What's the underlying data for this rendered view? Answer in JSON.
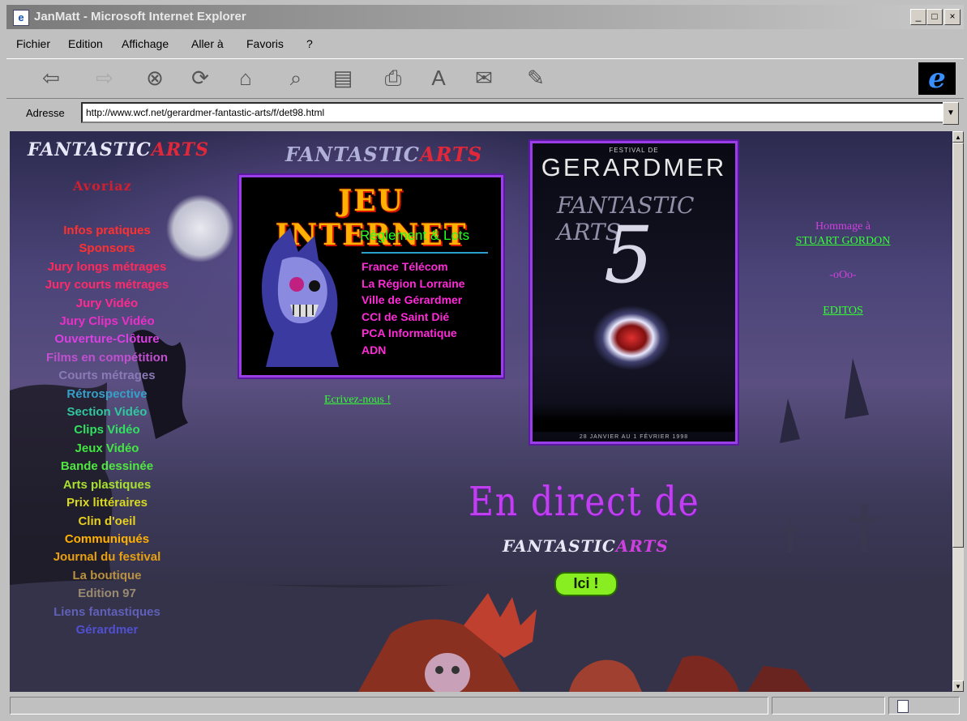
{
  "window": {
    "title": "JanMatt - Microsoft Internet Explorer",
    "controls": {
      "minimize": "_",
      "maximize": "□",
      "close": "×"
    }
  },
  "menu": [
    "Fichier",
    "Edition",
    "Affichage",
    "Aller à",
    "Favoris",
    "?"
  ],
  "toolbar": {
    "buttons": [
      {
        "name": "back-icon",
        "glyph": "⇦"
      },
      {
        "name": "forward-icon",
        "glyph": "⇨"
      },
      {
        "name": "stop-icon",
        "glyph": "⊗"
      },
      {
        "name": "refresh-icon",
        "glyph": "⟳"
      },
      {
        "name": "home-icon",
        "glyph": "⌂"
      },
      {
        "name": "search-icon",
        "glyph": "⌕"
      },
      {
        "name": "favorites-icon",
        "glyph": "▤"
      },
      {
        "name": "print-icon",
        "glyph": "⎙"
      },
      {
        "name": "font-icon",
        "glyph": "A"
      },
      {
        "name": "mail-icon",
        "glyph": "✉"
      },
      {
        "name": "edit-icon",
        "glyph": "✎"
      }
    ],
    "ie_logo": "e"
  },
  "address": {
    "label": "Adresse",
    "url": "http://www.wcf.net/gerardmer-fantastic-arts/f/det98.html"
  },
  "page": {
    "logo_main": {
      "part1": "FANTASTIC",
      "part2": "ARTS"
    },
    "logo_small": "Avoriaz",
    "nav": [
      {
        "label": "Infos pratiques",
        "color": "#ff3030"
      },
      {
        "label": "Sponsors",
        "color": "#ff3030"
      },
      {
        "label": "Jury longs métrages",
        "color": "#ff2a5a"
      },
      {
        "label": "Jury courts métrages",
        "color": "#ff2a6a"
      },
      {
        "label": "Jury Vidéo",
        "color": "#ff2a90"
      },
      {
        "label": "Jury Clips Vidéo",
        "color": "#e830c8"
      },
      {
        "label": "Ouverture-Clôture",
        "color": "#d840e0"
      },
      {
        "label": "Films en compétition",
        "color": "#c050d0"
      },
      {
        "label": "Courts métrages",
        "color": "#8a7ab8"
      },
      {
        "label": "Rétrospective",
        "color": "#36a0c8"
      },
      {
        "label": "Section Vidéo",
        "color": "#30c8a0"
      },
      {
        "label": "Clips Vidéo",
        "color": "#30e060"
      },
      {
        "label": "Jeux Vidéo",
        "color": "#40e840"
      },
      {
        "label": "Bande dessinée",
        "color": "#50e840"
      },
      {
        "label": "Arts plastiques",
        "color": "#a8e030"
      },
      {
        "label": "Prix littéraires",
        "color": "#d8d820"
      },
      {
        "label": "Clin d'oeil",
        "color": "#e8d020"
      },
      {
        "label": "Communiqués",
        "color": "#ffb000"
      },
      {
        "label": "Journal du festival",
        "color": "#e8a010"
      },
      {
        "label": "La boutique",
        "color": "#b89040"
      },
      {
        "label": "Edition 97",
        "color": "#9a8a70"
      },
      {
        "label": "Liens fantastiques",
        "color": "#6060b8"
      },
      {
        "label": "Gérardmer",
        "color": "#5050d0"
      }
    ],
    "jeu": {
      "title": "JEU INTERNET",
      "reglement": "Règlement & Lots",
      "sponsors": [
        "France Télécom",
        "La Région Lorraine",
        "Ville de Gérardmer",
        "CCI de Saint Dié",
        "PCA Informatique",
        "ADN"
      ]
    },
    "poster": {
      "top": "FESTIVAL DE",
      "title": "GERARDMER",
      "subtitle": "FANTASTIC ARTS",
      "number": "5",
      "bottom": "28 JANVIER AU 1 FÉVRIER 1998"
    },
    "right": {
      "hommage": "Hommage à",
      "stuart": "STUART GORDON",
      "separator": "-oOo-",
      "edito": "EDITOS"
    },
    "ecrivez": "Ecrivez-nous !",
    "direct": "En direct de",
    "ici": "Ici !"
  },
  "statusbar": {
    "text": "",
    "zone": ""
  },
  "colors": {
    "frame": "#c0c0c0",
    "link": "#33ff33",
    "accent_purple": "#9a3ee8"
  }
}
